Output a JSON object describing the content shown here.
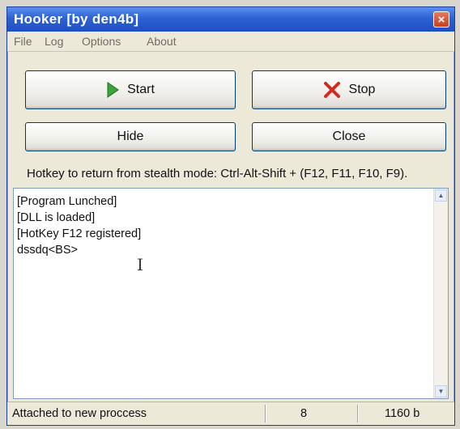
{
  "window": {
    "title": "Hooker  [by den4b]",
    "close_glyph": "×"
  },
  "menu": [
    "File",
    "Log",
    "Options",
    "About"
  ],
  "buttons": {
    "start": "Start",
    "stop": "Stop",
    "hide": "Hide",
    "close": "Close"
  },
  "hotkey_text": "Hotkey to return from stealth mode: Ctrl-Alt-Shift + (F12, F11, F10, F9).",
  "log": [
    "[Program Lunched]",
    "[DLL is loaded]",
    "[HotKey F12 registered]",
    "dssdq<BS>"
  ],
  "status": {
    "message": "Attached to new proccess",
    "count": "8",
    "size": "1160 b"
  },
  "icons": {
    "start": "play-icon",
    "stop": "x-icon"
  },
  "colors": {
    "titlebar": "#2c62d4",
    "start_icon": "#3aa53a",
    "stop_icon": "#d22b1f"
  }
}
